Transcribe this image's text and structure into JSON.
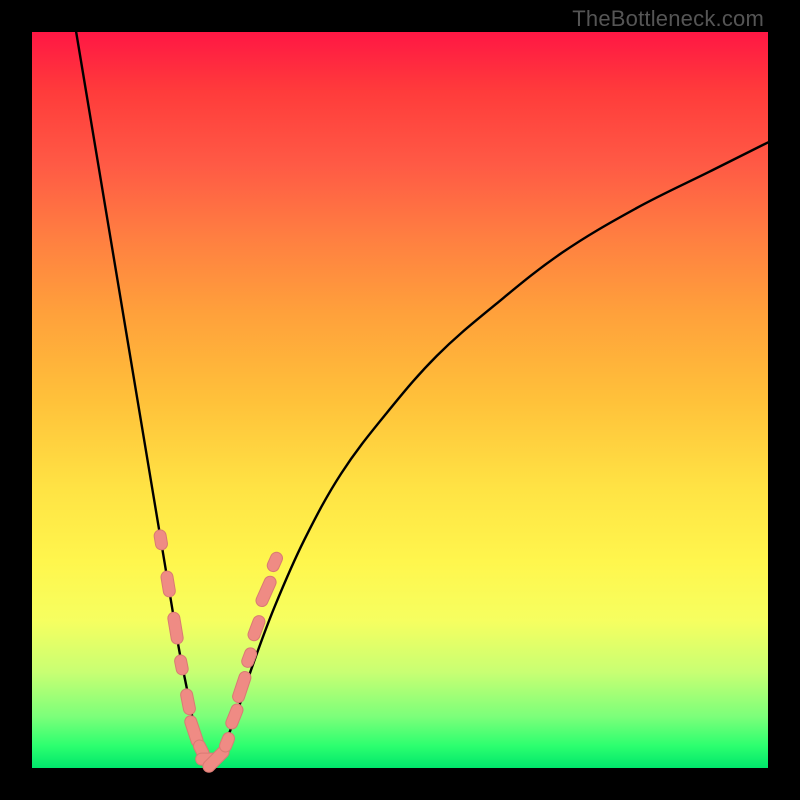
{
  "watermark": "TheBottleneck.com",
  "colors": {
    "background": "#000000",
    "curve_stroke": "#000000",
    "marker_fill": "#ef8b84",
    "marker_stroke": "#d97a73",
    "gradient_top": "#ff1744",
    "gradient_bottom": "#00e66b"
  },
  "chart_data": {
    "type": "line",
    "title": "",
    "xlabel": "",
    "ylabel": "",
    "xlim": [
      0,
      100
    ],
    "ylim": [
      0,
      100
    ],
    "grid": false,
    "legend": false,
    "note": "Bottleneck-style V-curve. Two branches descending to a flat minimum near x≈24. Y axis reads as bottleneck % (0 at bottom / green, 100 at top / red). Values estimated from pixel positions; no numeric labels present in image.",
    "series": [
      {
        "name": "left-branch",
        "x": [
          6,
          8,
          10,
          12,
          14,
          16,
          18,
          19,
          20,
          21,
          22,
          23,
          24
        ],
        "y": [
          100,
          88,
          76,
          64,
          52,
          40,
          28,
          22,
          16,
          11,
          6,
          3,
          1
        ]
      },
      {
        "name": "right-branch",
        "x": [
          24,
          26,
          28,
          30,
          33,
          37,
          42,
          48,
          55,
          63,
          72,
          82,
          92,
          100
        ],
        "y": [
          1,
          3,
          8,
          14,
          22,
          31,
          40,
          48,
          56,
          63,
          70,
          76,
          81,
          85
        ]
      },
      {
        "name": "minimum-band",
        "x": [
          22.5,
          25.5
        ],
        "y": [
          1,
          1
        ]
      }
    ],
    "markers": {
      "note": "Salmon capsule/dot markers clustered on lower portions of both branches and across the minimum.",
      "points": [
        {
          "x": 17.5,
          "y": 31
        },
        {
          "x": 18.5,
          "y": 25
        },
        {
          "x": 19.5,
          "y": 19
        },
        {
          "x": 20.3,
          "y": 14
        },
        {
          "x": 21.2,
          "y": 9
        },
        {
          "x": 22.0,
          "y": 5
        },
        {
          "x": 23.0,
          "y": 2.5
        },
        {
          "x": 24.0,
          "y": 1.2
        },
        {
          "x": 25.0,
          "y": 1.2
        },
        {
          "x": 26.5,
          "y": 3.5
        },
        {
          "x": 27.5,
          "y": 7
        },
        {
          "x": 28.5,
          "y": 11
        },
        {
          "x": 29.5,
          "y": 15
        },
        {
          "x": 30.5,
          "y": 19
        },
        {
          "x": 31.8,
          "y": 24
        },
        {
          "x": 33.0,
          "y": 28
        }
      ]
    }
  }
}
